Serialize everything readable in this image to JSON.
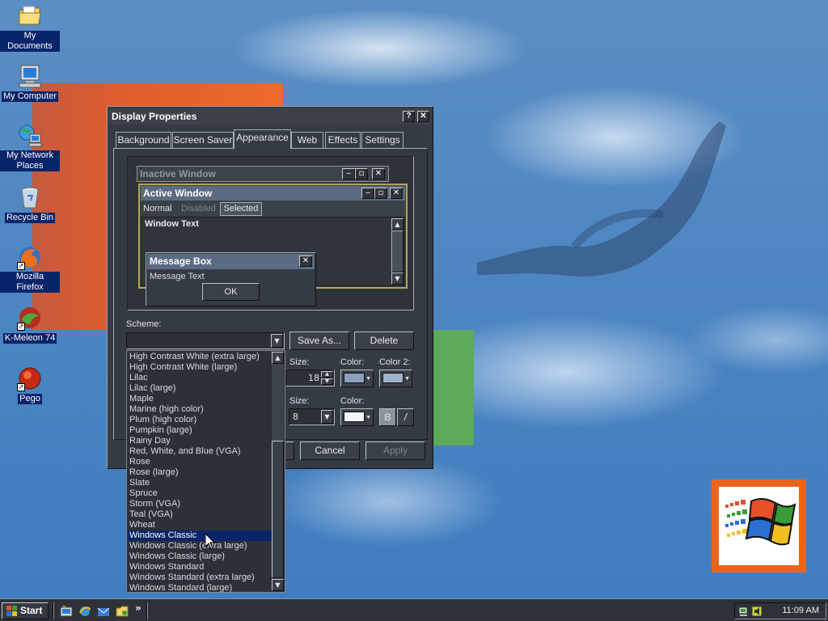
{
  "desktop_icons": [
    {
      "label": "My Documents",
      "icon": "folder-icon"
    },
    {
      "label": "My Computer",
      "icon": "computer-icon"
    },
    {
      "label": "My Network Places",
      "icon": "network-icon"
    },
    {
      "label": "Recycle Bin",
      "icon": "recycle-bin-icon"
    },
    {
      "label": "Mozilla Firefox",
      "icon": "firefox-icon"
    },
    {
      "label": "K-Meleon 74",
      "icon": "kmeleon-icon"
    },
    {
      "label": "Pego",
      "icon": "pego-icon"
    }
  ],
  "window": {
    "title": "Display Properties",
    "help_button": "?",
    "close_button": "✕",
    "tabs": [
      "Background",
      "Screen Saver",
      "Appearance",
      "Web",
      "Effects",
      "Settings"
    ],
    "active_tab": "Appearance"
  },
  "preview": {
    "inactive_title": "Inactive Window",
    "active_title": "Active Window",
    "menu_normal": "Normal",
    "menu_disabled": "Disabled",
    "menu_selected": "Selected",
    "window_text": "Window Text",
    "message_box_title": "Message Box",
    "message_text": "Message Text",
    "ok": "OK"
  },
  "scheme": {
    "label": "Scheme:",
    "value": "",
    "save_as": "Save As...",
    "delete": "Delete",
    "items": [
      "High Contrast White (extra large)",
      "High Contrast White (large)",
      "Lilac",
      "Lilac (large)",
      "Maple",
      "Marine (high color)",
      "Plum (high color)",
      "Pumpkin (large)",
      "Rainy Day",
      "Red, White, and Blue (VGA)",
      "Rose",
      "Rose (large)",
      "Slate",
      "Spruce",
      "Storm (VGA)",
      "Teal (VGA)",
      "Wheat",
      "Windows Classic",
      "Windows Classic (extra large)",
      "Windows Classic (large)",
      "Windows Standard",
      "Windows Standard (extra large)",
      "Windows Standard (large)"
    ],
    "selected": "Windows Classic"
  },
  "item_controls": {
    "size_label": "Size:",
    "size_value": "18",
    "color_label": "Color:",
    "color2_label": "Color 2:",
    "color1": "#8aa0bd",
    "color2": "#9fb3cc"
  },
  "font_controls": {
    "size_label": "Size:",
    "size_value": "8",
    "color_label": "Color:",
    "color": "#f4f6f8",
    "bold": "B",
    "italic": "/"
  },
  "buttons": {
    "cancel": "Cancel",
    "apply": "Apply"
  },
  "taskbar": {
    "start": "Start",
    "clock": "11:09 AM",
    "quicklaunch_more": "»"
  },
  "colors": {
    "window_bg": "#353b44",
    "selection": "#0a246a",
    "active_title": "#5a6b83",
    "inactive_title": "#404650"
  }
}
